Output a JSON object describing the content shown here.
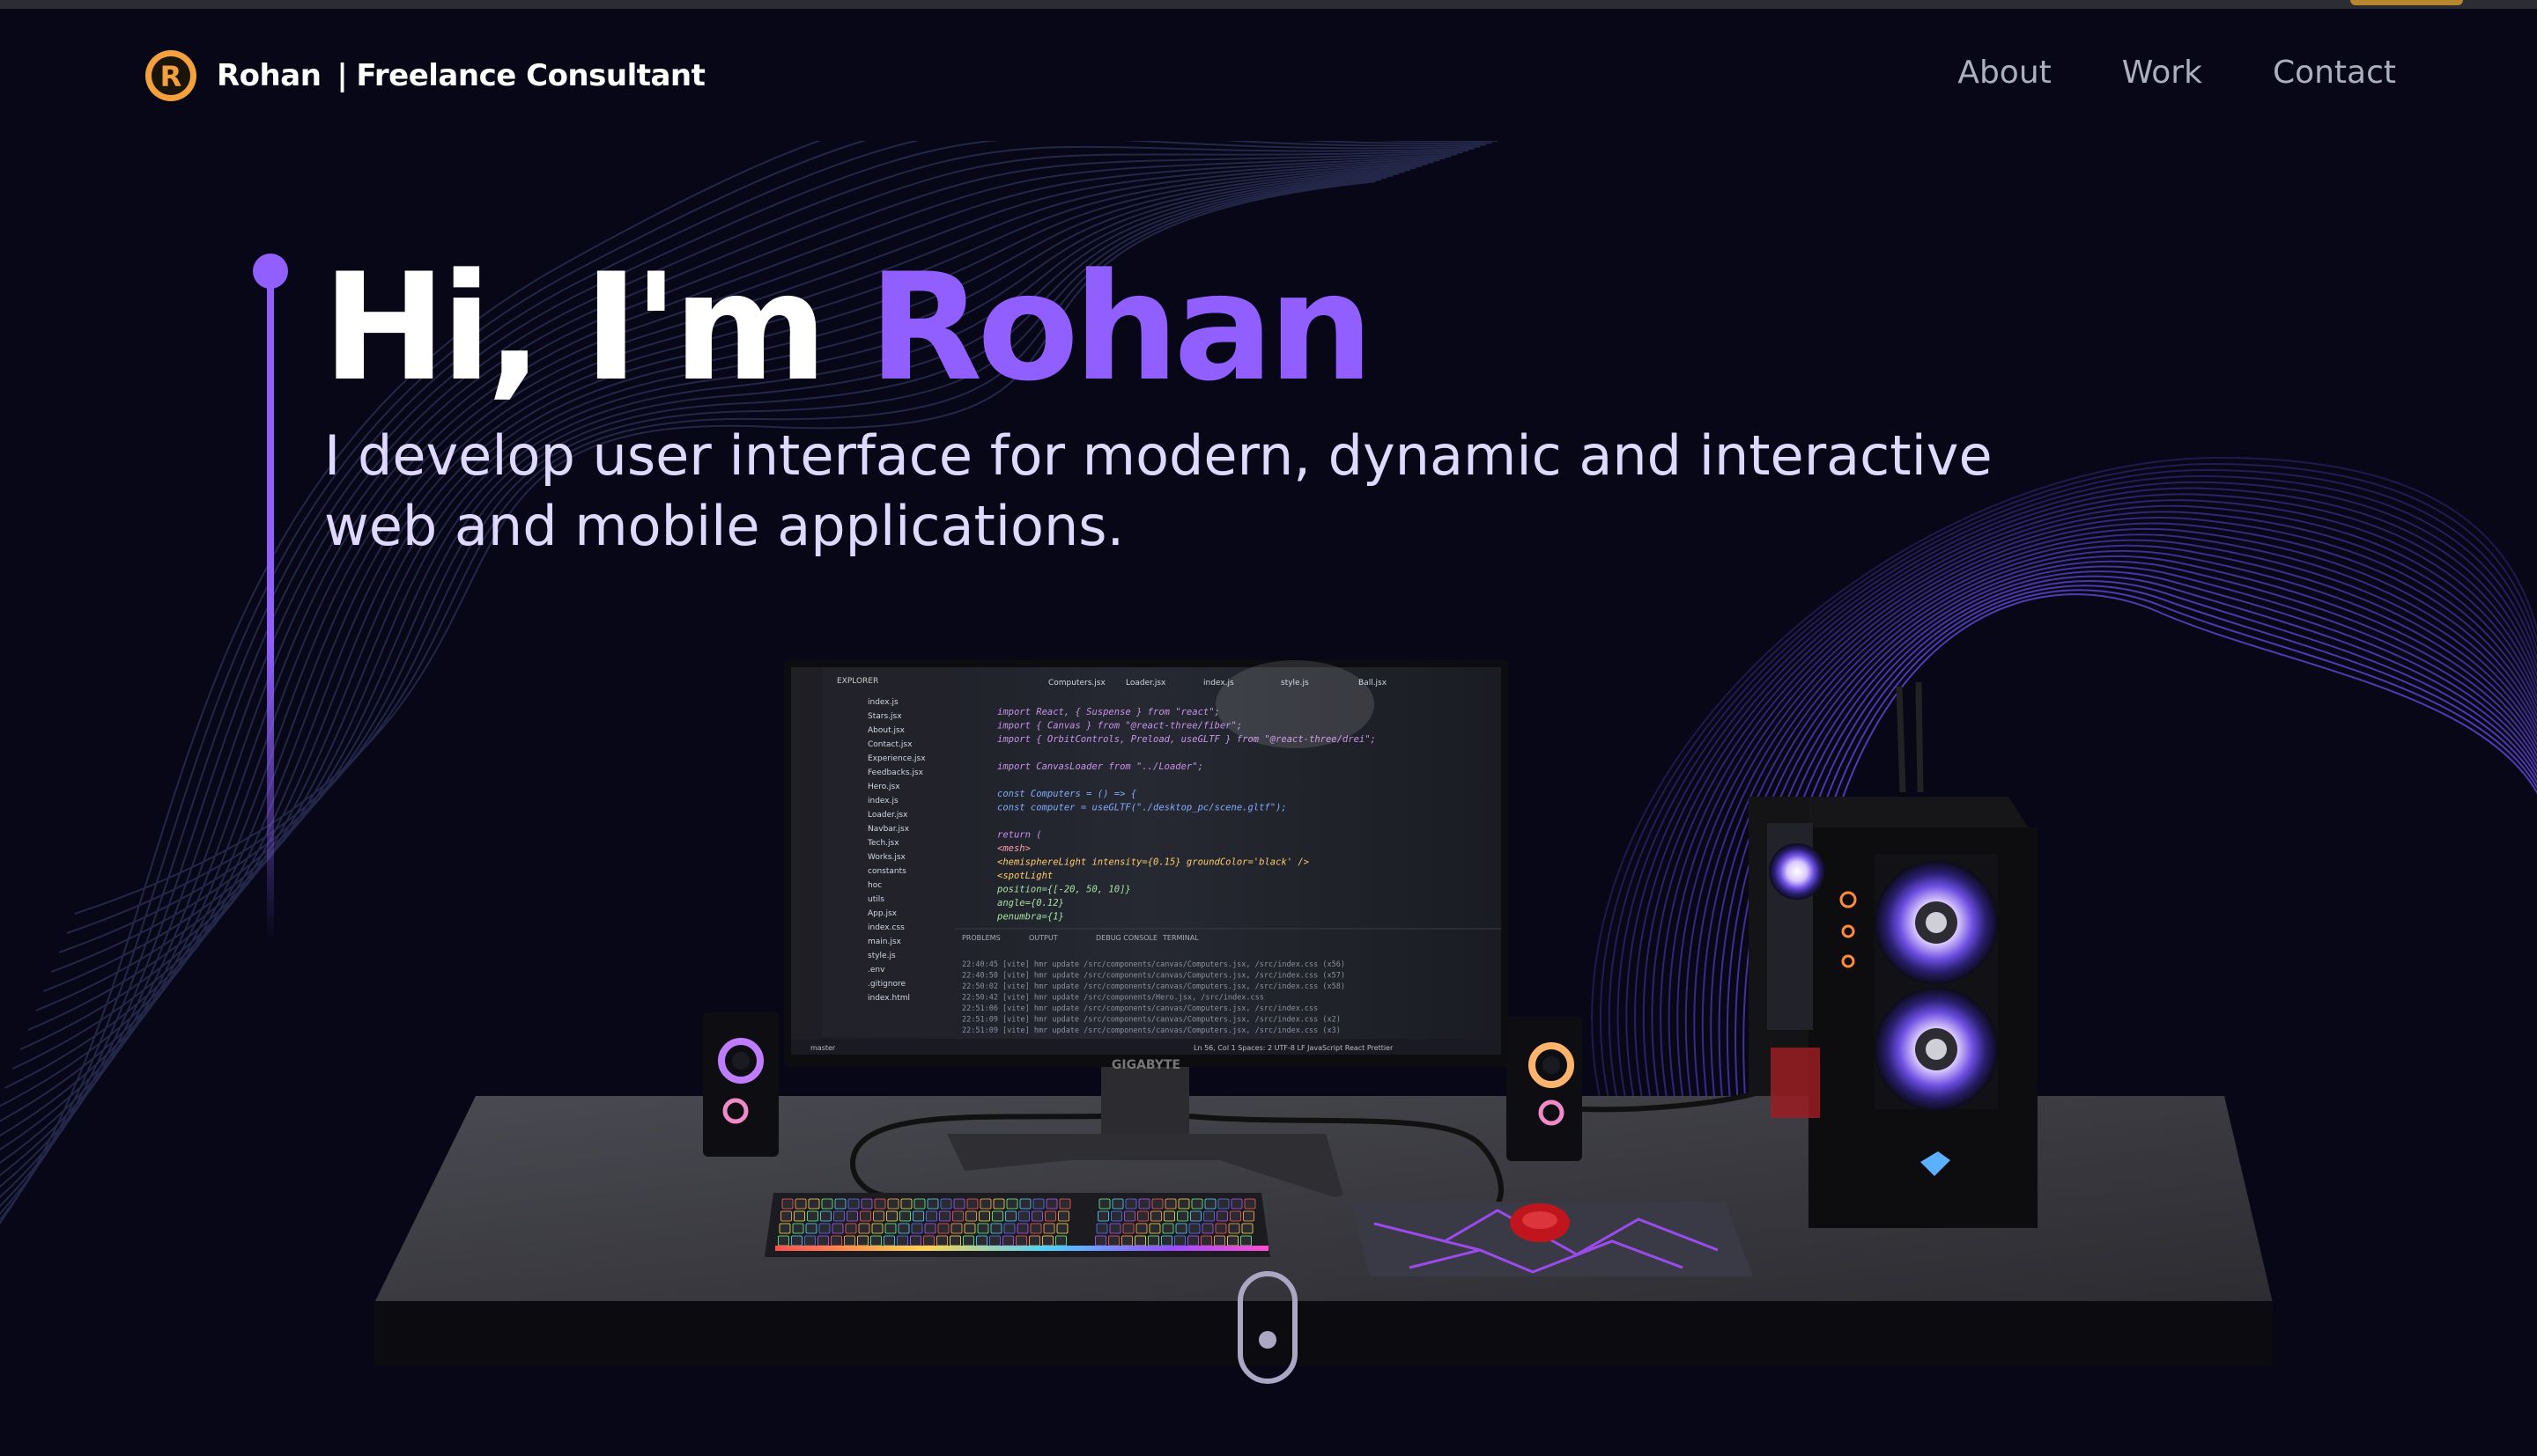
{
  "navbar": {
    "brand_name": "Rohan",
    "brand_separator": "|",
    "brand_role": "Freelance Consultant",
    "logo_letter": "R",
    "links": [
      {
        "label": "About",
        "icon": null
      },
      {
        "label": "Work",
        "icon": null
      },
      {
        "label": "Contact",
        "icon": null
      }
    ]
  },
  "hero": {
    "greeting": "Hi, I'm ",
    "name": "Rohan",
    "subtitle": "I develop user interface for modern, dynamic and interactive web and mobile applications."
  },
  "scene": {
    "monitor_brand": "GIGABYTE",
    "editor": {
      "tabs": [
        "Computers.jsx",
        "Loader.jsx",
        "index.js",
        "style.js",
        "Ball.jsx"
      ],
      "explorer_label": "EXPLORER",
      "files": [
        "index.js",
        "Stars.jsx",
        "About.jsx",
        "Contact.jsx",
        "Experience.jsx",
        "Feedbacks.jsx",
        "Hero.jsx",
        "index.js",
        "Loader.jsx",
        "Navbar.jsx",
        "Tech.jsx",
        "Works.jsx",
        "constants",
        "hoc",
        "utils",
        "App.jsx",
        "index.css",
        "main.jsx",
        "style.js",
        ".env",
        ".gitignore",
        "index.html"
      ],
      "code_lines": [
        "import React, { Suspense } from \"react\";",
        "import { Canvas } from \"@react-three/fiber\";",
        "import { OrbitControls, Preload, useGLTF } from \"@react-three/drei\";",
        "",
        "import CanvasLoader from \"../Loader\";",
        "",
        "const Computers = () => {",
        "  const computer = useGLTF(\"./desktop_pc/scene.gltf\");",
        "",
        "  return (",
        "    <mesh>",
        "      <hemisphereLight intensity={0.15} groundColor='black' />",
        "      <spotLight",
        "        position={[-20, 50, 10]}",
        "        angle={0.12}",
        "        penumbra={1}"
      ],
      "panel_tabs": [
        "PROBLEMS",
        "OUTPUT",
        "DEBUG CONSOLE",
        "TERMINAL"
      ],
      "terminal_lines": [
        "22:40:45 [vite] hmr update /src/components/canvas/Computers.jsx, /src/index.css (x56)",
        "22:40:50 [vite] hmr update /src/components/canvas/Computers.jsx, /src/index.css (x57)",
        "22:50:02 [vite] hmr update /src/components/canvas/Computers.jsx, /src/index.css (x58)",
        "22:50:42 [vite] hmr update /src/components/Hero.jsx, /src/index.css",
        "22:51:06 [vite] hmr update /src/components/canvas/Computers.jsx, /src/index.css",
        "22:51:09 [vite] hmr update /src/components/canvas/Computers.jsx, /src/index.css (x2)",
        "22:51:09 [vite] hmr update /src/components/canvas/Computers.jsx, /src/index.css (x3)"
      ],
      "status_left": "master",
      "status_right": "Ln 56, Col 1   Spaces: 2   UTF-8   LF   JavaScript React   Prettier"
    }
  },
  "colors": {
    "accent": "#915eff",
    "background": "#070717",
    "nav_link": "#aab0bd",
    "logo_orange": "#f3a03d"
  }
}
